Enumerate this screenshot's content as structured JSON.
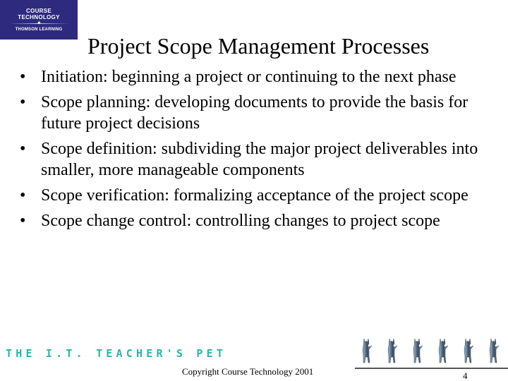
{
  "logo": {
    "line1": "COURSE",
    "line2": "TECHNOLOGY",
    "line3": "THOMSON LEARNING",
    "background": "#2e2a7e"
  },
  "slide": {
    "title": "Project Scope Management Processes",
    "bullet_glyph": "•",
    "bullets": [
      "Initiation: beginning a project or continuing to the next phase",
      "Scope planning: developing documents to provide the basis for future project decisions",
      "Scope definition: subdividing the major project deliverables into smaller, more manageable components",
      "Scope verification: formalizing acceptance of the project scope",
      "Scope change control: controlling changes to project scope"
    ]
  },
  "footer": {
    "brand": "THE I.T. TEACHER'S PET",
    "brand_color": "#2bb5a8",
    "copyright": "Copyright Course Technology 2001",
    "page_number": "4",
    "mascot_icons": [
      "dog-icon",
      "dog-icon",
      "dog-icon",
      "dog-icon",
      "dog-icon",
      "dog-icon"
    ]
  }
}
